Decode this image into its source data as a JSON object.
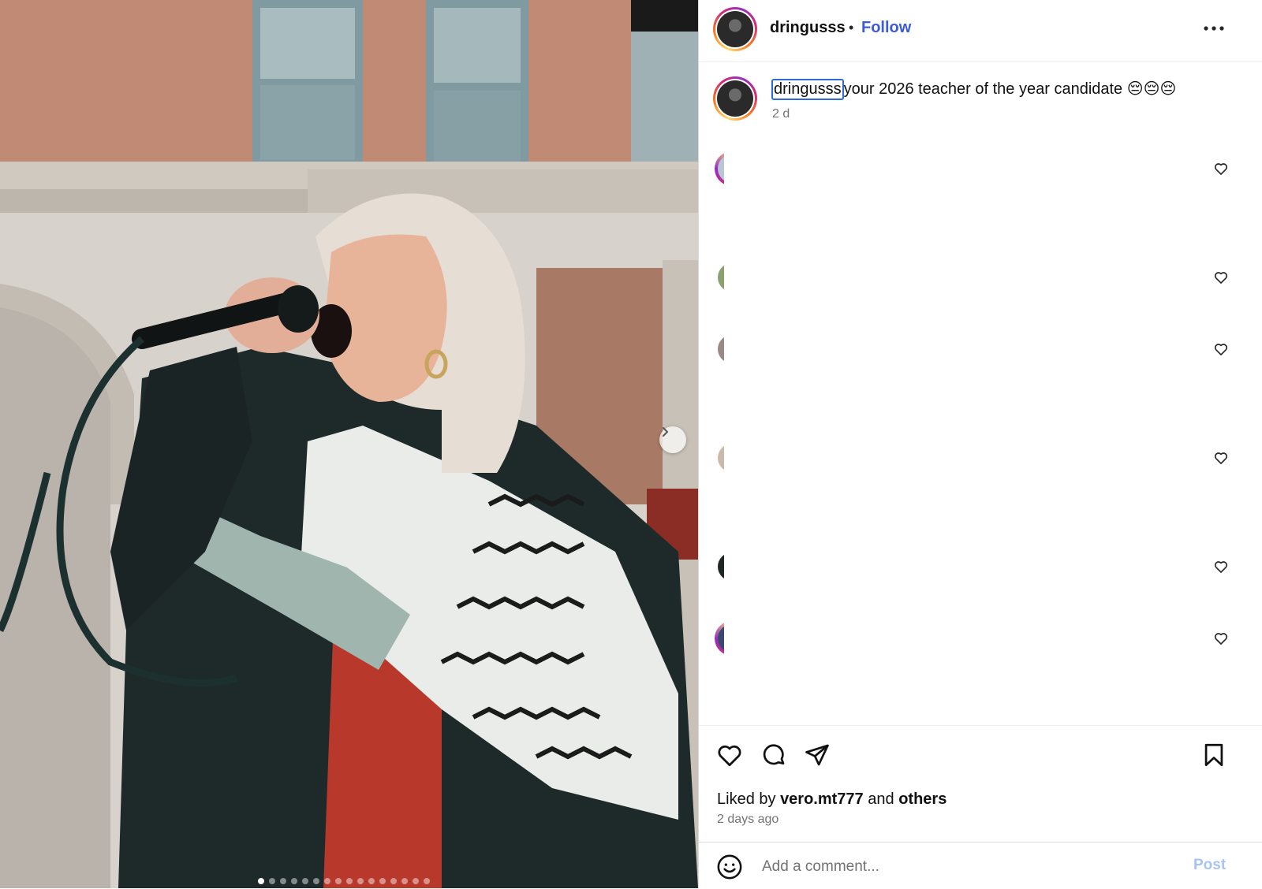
{
  "post": {
    "username": "dringusss",
    "follow_label": "Follow",
    "separator": "•",
    "caption_user": "dringusss",
    "caption_text": "your 2026 teacher of the year candidate 😔😔😔",
    "caption_age": "2 d",
    "liked_prefix": "Liked by",
    "liked_user": "vero.mt777",
    "liked_and": "and",
    "liked_others": "others",
    "posted_time": "2 days ago"
  },
  "composer": {
    "placeholder": "Add a comment...",
    "post_label": "Post"
  },
  "carousel": {
    "slide_count": 16,
    "active_index": 0
  },
  "icons": {
    "more": "more-options-icon",
    "next": "chevron-right-icon",
    "like": "heart-icon",
    "comment": "comment-icon",
    "share": "paper-plane-icon",
    "save": "bookmark-icon",
    "emoji": "emoji-icon"
  },
  "colors": {
    "link": "#3b5bdb",
    "muted": "#737373",
    "post_disabled": "#a9c3f5",
    "focus": "#2e6bd6"
  }
}
